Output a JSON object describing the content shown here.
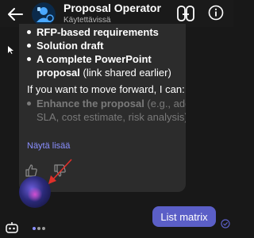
{
  "header": {
    "title": "Proposal Operator",
    "status": "Käytettävissä"
  },
  "message": {
    "bullets": [
      {
        "text": "RFP-based requirements"
      },
      {
        "text": "Solution draft"
      },
      {
        "bold": "A complete PowerPoint proposal",
        "rest": " (link shared earlier)"
      }
    ],
    "followup": "If you want to move forward, I can:",
    "faded_bullet": {
      "bold": "Enhance the proposal",
      "rest": " (e.g., add SLA, cost estimate, risk analysis)"
    },
    "show_more": "Näytä lisää"
  },
  "user_message": {
    "text": "List matrix"
  },
  "colors": {
    "accent": "#5b5fc7",
    "link": "#8a8fff",
    "annotation_arrow": "#e0302a"
  },
  "icons": [
    "back-arrow-icon",
    "bot-avatar-icon",
    "copilot-icon",
    "info-icon",
    "thumbs-up-icon",
    "thumbs-down-icon",
    "read-receipt-icon",
    "bot-icon",
    "typing-indicator-icon"
  ]
}
